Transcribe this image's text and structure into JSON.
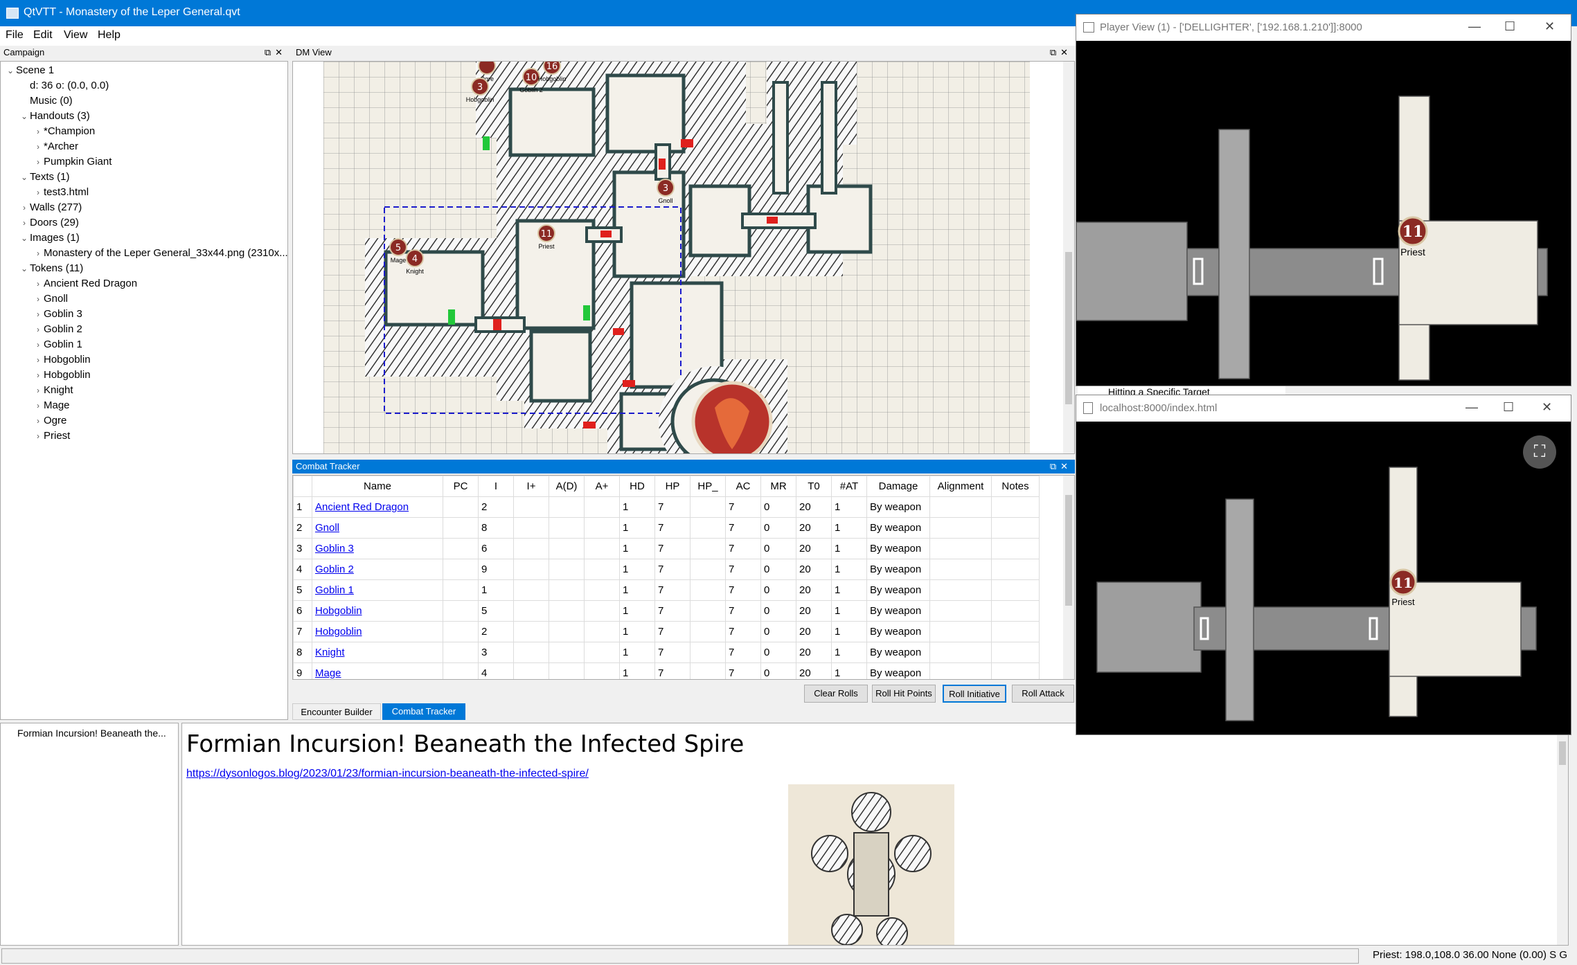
{
  "app": {
    "title": "QtVTT - Monastery of the Leper General.qvt",
    "menu": [
      "File",
      "Edit",
      "View",
      "Help"
    ]
  },
  "campaign": {
    "panel_title": "Campaign",
    "tree": [
      {
        "label": "Scene 1",
        "level": 0,
        "expander": "down"
      },
      {
        "label": "d: 36 o: (0.0, 0.0)",
        "level": 1,
        "expander": "none"
      },
      {
        "label": "Music (0)",
        "level": 1,
        "expander": "none"
      },
      {
        "label": "Handouts (3)",
        "level": 1,
        "expander": "down"
      },
      {
        "label": "*Champion",
        "level": 2,
        "expander": "right"
      },
      {
        "label": "*Archer",
        "level": 2,
        "expander": "right"
      },
      {
        "label": "Pumpkin Giant",
        "level": 2,
        "expander": "right"
      },
      {
        "label": "Texts (1)",
        "level": 1,
        "expander": "down"
      },
      {
        "label": "test3.html",
        "level": 2,
        "expander": "right"
      },
      {
        "label": "Walls (277)",
        "level": 1,
        "expander": "right"
      },
      {
        "label": "Doors (29)",
        "level": 1,
        "expander": "right"
      },
      {
        "label": "Images (1)",
        "level": 1,
        "expander": "down"
      },
      {
        "label": "Monastery of the Leper General_33x44.png (2310x...",
        "level": 2,
        "expander": "right"
      },
      {
        "label": "Tokens (11)",
        "level": 1,
        "expander": "down"
      },
      {
        "label": "Ancient Red Dragon",
        "level": 2,
        "expander": "right"
      },
      {
        "label": "Gnoll",
        "level": 2,
        "expander": "right"
      },
      {
        "label": "Goblin 3",
        "level": 2,
        "expander": "right"
      },
      {
        "label": "Goblin 2",
        "level": 2,
        "expander": "right"
      },
      {
        "label": "Goblin 1",
        "level": 2,
        "expander": "right"
      },
      {
        "label": "Hobgoblin",
        "level": 2,
        "expander": "right"
      },
      {
        "label": "Hobgoblin",
        "level": 2,
        "expander": "right"
      },
      {
        "label": "Knight",
        "level": 2,
        "expander": "right"
      },
      {
        "label": "Mage",
        "level": 2,
        "expander": "right"
      },
      {
        "label": "Ogre",
        "level": 2,
        "expander": "right"
      },
      {
        "label": "Priest",
        "level": 2,
        "expander": "right"
      }
    ]
  },
  "dm_view": {
    "panel_title": "DM View",
    "tokens": [
      {
        "label": "Ogre",
        "badge": ""
      },
      {
        "label": "Goblin 2",
        "badge": "10"
      },
      {
        "label": "Hobgoblin",
        "badge": "16"
      },
      {
        "label": "Hobgoblin",
        "badge": "3"
      },
      {
        "label": "Gnoll",
        "badge": "3"
      },
      {
        "label": "Priest",
        "badge": "11"
      },
      {
        "label": "Mage",
        "badge": "5"
      },
      {
        "label": "Knight",
        "badge": "4"
      }
    ]
  },
  "combat_tracker": {
    "panel_title": "Combat Tracker",
    "columns": [
      "Name",
      "PC",
      "I",
      "I+",
      "A(D)",
      "A+",
      "HD",
      "HP",
      "HP_",
      "AC",
      "MR",
      "T0",
      "#AT",
      "Damage",
      "Alignment",
      "Notes"
    ],
    "rows": [
      {
        "n": "1",
        "name": "Ancient Red Dragon",
        "pc": "",
        "i": "2",
        "ip": "",
        "ad": "",
        "ap": "",
        "hd": "1",
        "hp": "7",
        "hpm": "",
        "ac": "7",
        "mr": "0",
        "t0": "20",
        "at": "1",
        "dmg": "By weapon",
        "al": "",
        "notes": ""
      },
      {
        "n": "2",
        "name": "Gnoll",
        "pc": "",
        "i": "8",
        "ip": "",
        "ad": "",
        "ap": "",
        "hd": "1",
        "hp": "7",
        "hpm": "",
        "ac": "7",
        "mr": "0",
        "t0": "20",
        "at": "1",
        "dmg": "By weapon",
        "al": "",
        "notes": ""
      },
      {
        "n": "3",
        "name": "Goblin 3",
        "pc": "",
        "i": "6",
        "ip": "",
        "ad": "",
        "ap": "",
        "hd": "1",
        "hp": "7",
        "hpm": "",
        "ac": "7",
        "mr": "0",
        "t0": "20",
        "at": "1",
        "dmg": "By weapon",
        "al": "",
        "notes": ""
      },
      {
        "n": "4",
        "name": "Goblin 2",
        "pc": "",
        "i": "9",
        "ip": "",
        "ad": "",
        "ap": "",
        "hd": "1",
        "hp": "7",
        "hpm": "",
        "ac": "7",
        "mr": "0",
        "t0": "20",
        "at": "1",
        "dmg": "By weapon",
        "al": "",
        "notes": ""
      },
      {
        "n": "5",
        "name": "Goblin 1",
        "pc": "",
        "i": "1",
        "ip": "",
        "ad": "",
        "ap": "",
        "hd": "1",
        "hp": "7",
        "hpm": "",
        "ac": "7",
        "mr": "0",
        "t0": "20",
        "at": "1",
        "dmg": "By weapon",
        "al": "",
        "notes": ""
      },
      {
        "n": "6",
        "name": "Hobgoblin",
        "pc": "",
        "i": "5",
        "ip": "",
        "ad": "",
        "ap": "",
        "hd": "1",
        "hp": "7",
        "hpm": "",
        "ac": "7",
        "mr": "0",
        "t0": "20",
        "at": "1",
        "dmg": "By weapon",
        "al": "",
        "notes": ""
      },
      {
        "n": "7",
        "name": "Hobgoblin",
        "pc": "",
        "i": "2",
        "ip": "",
        "ad": "",
        "ap": "",
        "hd": "1",
        "hp": "7",
        "hpm": "",
        "ac": "7",
        "mr": "0",
        "t0": "20",
        "at": "1",
        "dmg": "By weapon",
        "al": "",
        "notes": ""
      },
      {
        "n": "8",
        "name": "Knight",
        "pc": "",
        "i": "3",
        "ip": "",
        "ad": "",
        "ap": "",
        "hd": "1",
        "hp": "7",
        "hpm": "",
        "ac": "7",
        "mr": "0",
        "t0": "20",
        "at": "1",
        "dmg": "By weapon",
        "al": "",
        "notes": ""
      },
      {
        "n": "9",
        "name": "Mage",
        "pc": "",
        "i": "4",
        "ip": "",
        "ad": "",
        "ap": "",
        "hd": "1",
        "hp": "7",
        "hpm": "",
        "ac": "7",
        "mr": "0",
        "t0": "20",
        "at": "1",
        "dmg": "By weapon",
        "al": "",
        "notes": ""
      }
    ],
    "buttons": {
      "clear": "Clear Rolls",
      "hp": "Roll Hit Points",
      "init": "Roll Initiative",
      "attack": "Roll Attack"
    },
    "tabs": {
      "encounter": "Encounter Builder",
      "combat": "Combat Tracker"
    }
  },
  "document": {
    "list_item": "Formian Incursion! Beaneath the...",
    "heading": "Formian Incursion! Beaneath the Infected Spire",
    "link": "https://dysonlogos.blog/2023/01/23/formian-incursion-beaneath-the-infected-spire/"
  },
  "status": {
    "text": "Priest: 198.0,108.0 36.00 None (0.00) S G"
  },
  "player_view": {
    "title": "Player View (1) - ['DELLIGHTER', ['192.168.1.210']]:8000",
    "token_badge": "11",
    "token_label": "Priest",
    "peek_text": "Hitting a Specific Target"
  },
  "browser": {
    "title": "localhost:8000/index.html",
    "token_badge": "11",
    "token_label": "Priest"
  },
  "colors": {
    "accent": "#0078d7",
    "map_bg": "#f2efe6",
    "wall": "#2f4a4a",
    "door_red": "#e0201d",
    "door_green": "#22c83a"
  }
}
